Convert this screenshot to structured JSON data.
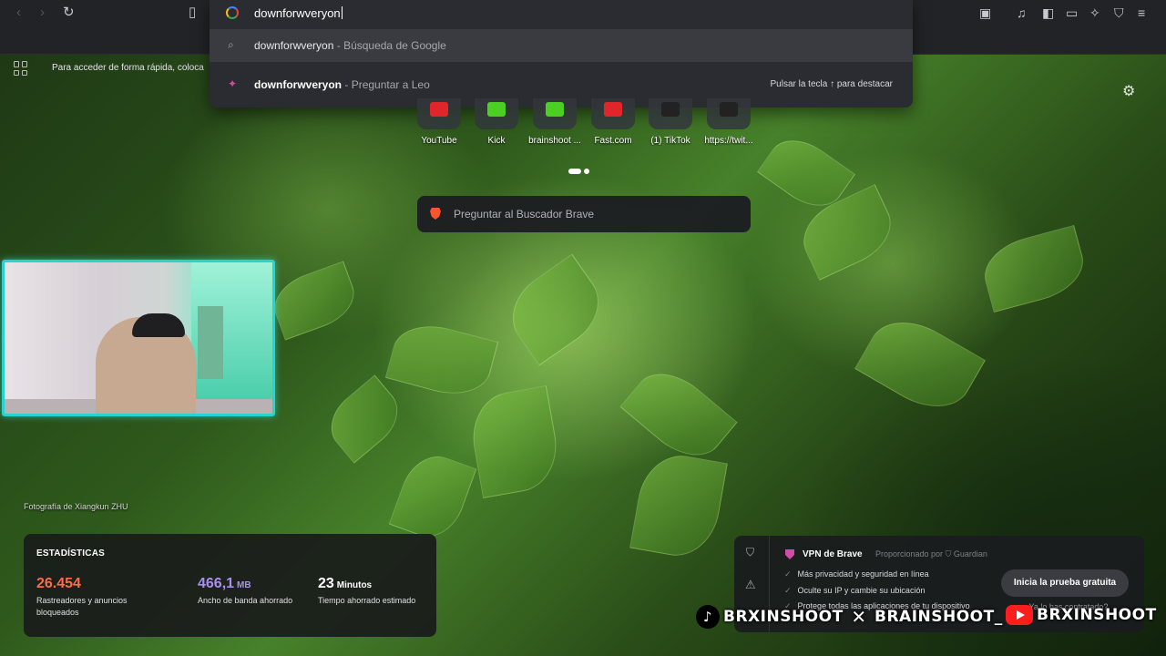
{
  "address_bar": {
    "query": "downforwveryon"
  },
  "bookmarks_bar": {
    "hint_text": "Para acceder de forma rápida, coloca"
  },
  "suggestions": [
    {
      "term": "downforwveryon",
      "detail": "Búsqueda de Google",
      "icon": "search-icon"
    },
    {
      "term": "downforwveryon",
      "detail": "Preguntar a Leo",
      "icon": "leo-icon",
      "hint": "Pulsar la tecla ↑ para destacar"
    }
  ],
  "top_sites": [
    {
      "label": "YouTube",
      "color": "#e0262b"
    },
    {
      "label": "Kick",
      "color": "#4ccf23"
    },
    {
      "label": "brainshoot ...",
      "color": "#4ccf23"
    },
    {
      "label": "Fast.com",
      "color": "#e0262b"
    },
    {
      "label": "(1) TikTok",
      "color": "#222222"
    },
    {
      "label": "https://twit...",
      "color": "#222222"
    }
  ],
  "search": {
    "placeholder": "Preguntar al Buscador Brave"
  },
  "photo_credit": "Fotografía de Xiangkun ZHU",
  "stats": {
    "heading": "ESTADÍSTICAS",
    "items": [
      {
        "value": "26.454",
        "unit": "",
        "color": "#ff6b46",
        "desc": "Rastreadores y anuncios bloqueados"
      },
      {
        "value": "466,1",
        "unit": "MB",
        "color": "#a98ff3",
        "desc": "Ancho de banda ahorrado"
      },
      {
        "value": "23",
        "unit": "Minutos",
        "color": "#ffffff",
        "desc": "Tiempo ahorrado estimado"
      }
    ]
  },
  "vpn": {
    "title": "VPN de Brave",
    "provider": "Proporcionado por",
    "provider_name": "Guardian",
    "features": [
      "Más privacidad y seguridad en línea",
      "Oculte su IP y cambie su ubicación",
      "Protege todas las aplicaciones de tu dispositivo"
    ],
    "cta": "Inicia la prueba gratuita",
    "already": "¿Ya lo has contratado?"
  },
  "social": [
    {
      "handle": "BRXINSHOOT",
      "icon": "tiktok-icon"
    },
    {
      "handle": "BRAINSHOOT_",
      "icon": "x-icon"
    },
    {
      "handle": "BRXINSHOOT",
      "icon": "youtube-icon"
    }
  ]
}
